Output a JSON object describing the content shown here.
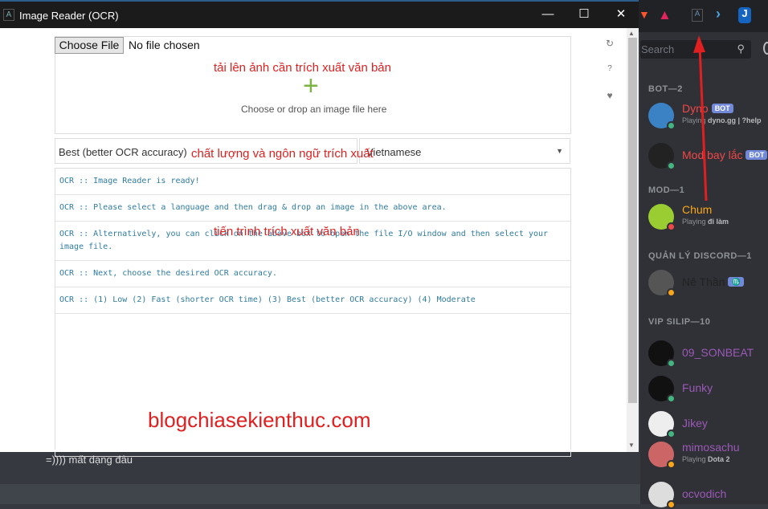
{
  "window": {
    "title": "Image Reader (OCR)",
    "minimize": "—",
    "maximize": "☐",
    "close": "✕"
  },
  "upload": {
    "button": "Choose File",
    "status": "No file chosen",
    "drop_text": "Choose or drop an image file here",
    "annotation": "tải lên ảnh cần trích xuất văn bản"
  },
  "options": {
    "accuracy": "Best (better OCR accuracy)",
    "language": "Vietnamese",
    "annotation": "chất lượng và ngôn ngữ trích xuất"
  },
  "log": {
    "lines": [
      "OCR :: Image Reader is ready!",
      "OCR :: Please select a language and then drag & drop an image in the above area.",
      "OCR :: Alternatively, you can click on the above box to open the file I/O window and then select your image file.",
      "OCR :: Next, choose the desired OCR accuracy.",
      "OCR :: (1) Low (2) Fast (shorter OCR time) (3) Best (better OCR accuracy) (4) Moderate"
    ],
    "annotation": "tiến  trình trích xuất văn bản"
  },
  "side_icons": {
    "refresh": "↻",
    "help": "?",
    "heart": "♥"
  },
  "watermark": "blogchiasekienthuc.com",
  "discord": {
    "message": "=)))) mất dạng đâu",
    "search_placeholder": "Search",
    "categories": [
      "BOT—2",
      "MOD—1",
      "QUẢN LÝ DISCORD—1",
      "VIP SILIP—10"
    ],
    "members": [
      {
        "name": "Dyno",
        "badge": "BOT",
        "activity_prefix": "Playing ",
        "activity": "dyno.gg | ?help",
        "color": "#f04747",
        "status": "online"
      },
      {
        "name": "Mod bay lắc",
        "badge": "BOT",
        "color": "#f04747",
        "status": "online"
      },
      {
        "name": "Chum",
        "activity_prefix": "Playing ",
        "activity": "đi làm",
        "color": "#faa61a",
        "status": "dnd"
      },
      {
        "name": "Nê Thần",
        "badge": "♏",
        "color": "#202225",
        "status": "idle"
      },
      {
        "name": "09_SONBEAT",
        "color": "#9b59b6",
        "status": "online"
      },
      {
        "name": "Funky",
        "color": "#9b59b6",
        "status": "online"
      },
      {
        "name": "Jikey",
        "color": "#9b59b6",
        "status": "online"
      },
      {
        "name": "mimosachu",
        "activity_prefix": "Playing ",
        "activity": "Dota 2",
        "color": "#9b59b6",
        "status": "idle"
      },
      {
        "name": "ocvodich",
        "color": "#9b59b6",
        "status": "idle"
      }
    ]
  },
  "colors": {
    "online": "#43b581",
    "idle": "#faa61a",
    "dnd": "#f04747",
    "annotation": "#e02020"
  }
}
